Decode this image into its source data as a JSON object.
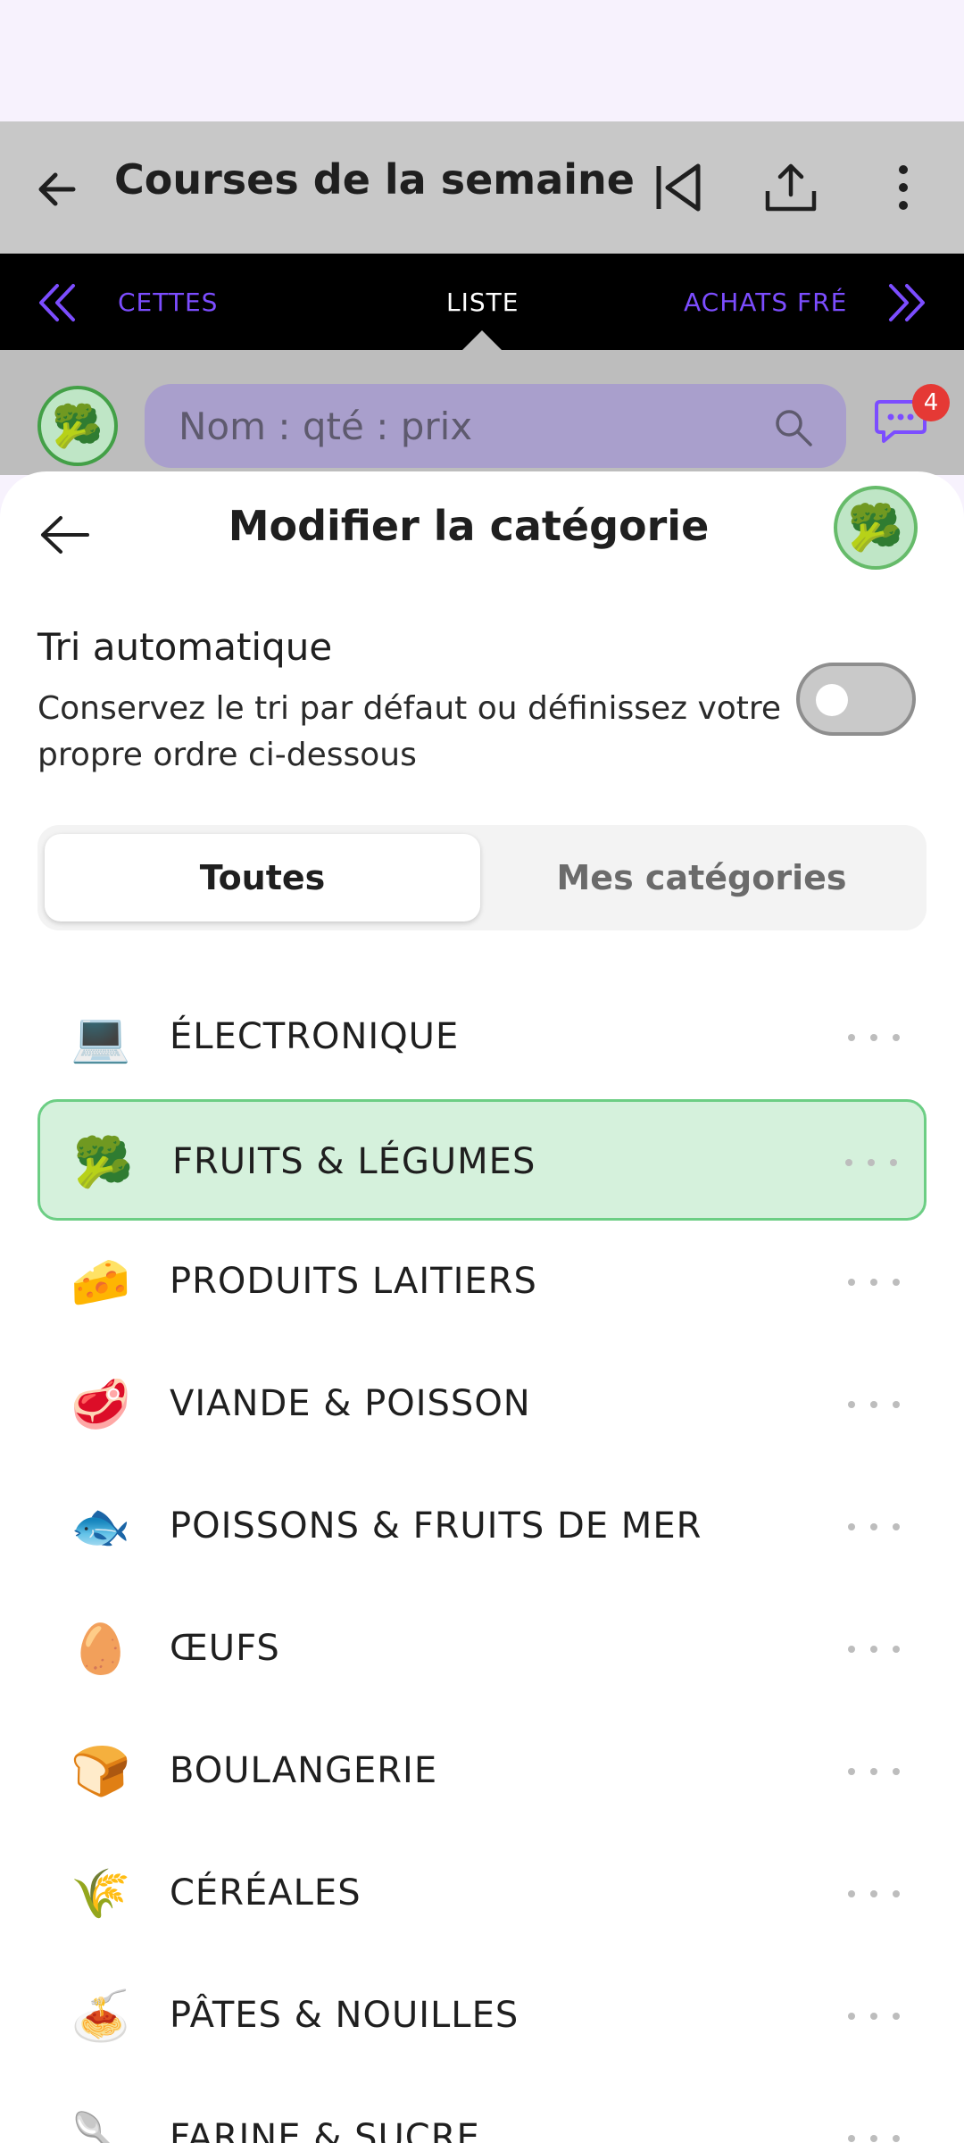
{
  "app_bar": {
    "title": "Courses de la semaine"
  },
  "tabs": {
    "left": "CETTES",
    "center": "LISTE",
    "right": "ACHATS FRÉ"
  },
  "background": {
    "search_placeholder": "Nom : qté : prix",
    "chat_badge": "4",
    "avatar_emoji": "🥦"
  },
  "sheet": {
    "title": "Modifier la catégorie",
    "avatar_emoji": "🥦",
    "auto_sort": {
      "title": "Tri automatique",
      "description": "Conservez le tri par défaut ou définissez votre propre ordre ci-dessous",
      "enabled": false
    },
    "segments": {
      "active": "Toutes",
      "inactive": "Mes catégories"
    },
    "categories": [
      {
        "emoji": "💻",
        "label": "ÉLECTRONIQUE",
        "selected": false
      },
      {
        "emoji": "🥦",
        "label": "FRUITS & LÉGUMES",
        "selected": true
      },
      {
        "emoji": "🧀",
        "label": "PRODUITS LAITIERS",
        "selected": false
      },
      {
        "emoji": "🥩",
        "label": "VIANDE & POISSON",
        "selected": false
      },
      {
        "emoji": "🐟",
        "label": "POISSONS & FRUITS DE MER",
        "selected": false
      },
      {
        "emoji": "🥚",
        "label": "ŒUFS",
        "selected": false
      },
      {
        "emoji": "🍞",
        "label": "BOULANGERIE",
        "selected": false
      },
      {
        "emoji": "🌾",
        "label": "CÉRÉALES",
        "selected": false
      },
      {
        "emoji": "🍝",
        "label": "PÂTES & NOUILLES",
        "selected": false
      },
      {
        "emoji": "🥄",
        "label": "FARINE & SUCRE",
        "selected": false
      }
    ]
  },
  "colors": {
    "accent": "#7c4dff",
    "selected_bg": "#d5f1dc",
    "selected_border": "#6cce84",
    "badge": "#e53935"
  }
}
